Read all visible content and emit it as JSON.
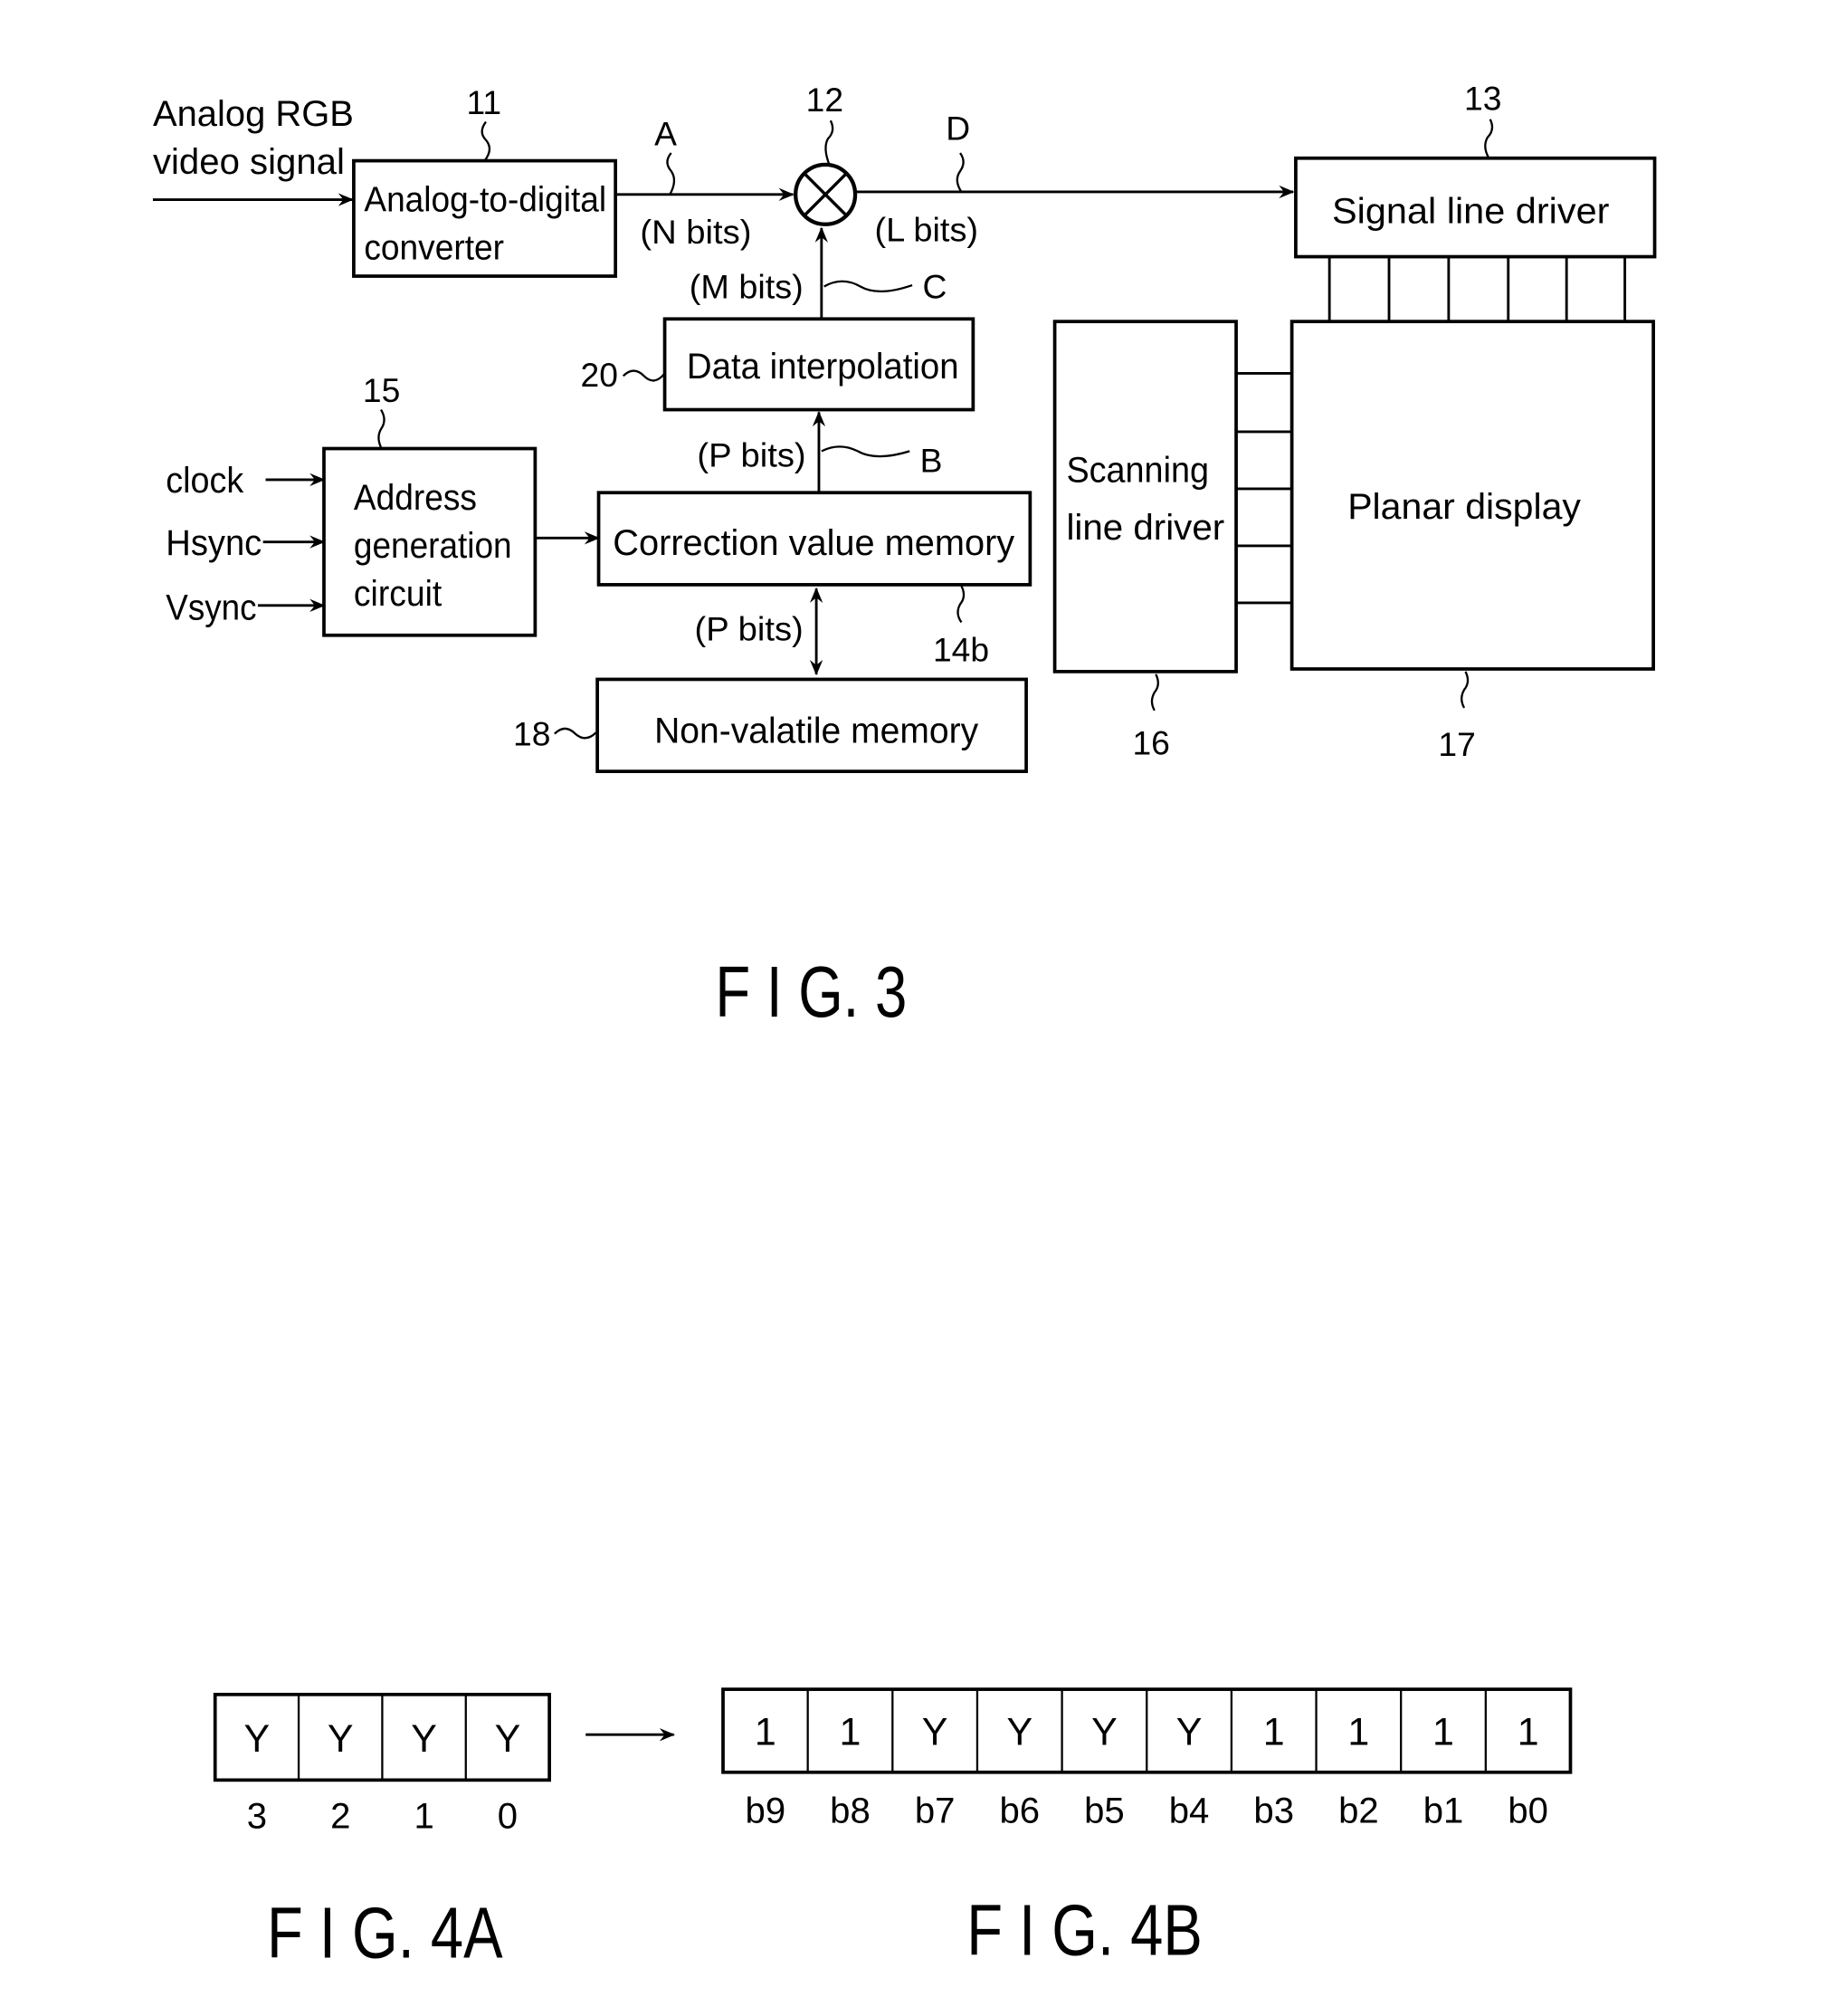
{
  "fig3": {
    "caption": "F I G. 3",
    "input_label_line1": "Analog RGB",
    "input_label_line2": "video signal",
    "adc": {
      "ref": "11",
      "line1": "Analog-to-digital",
      "line2": "converter"
    },
    "multiplier": {
      "ref": "12",
      "symbol": "multiply-circle"
    },
    "signal_a": {
      "name": "A",
      "bits": "(N bits)"
    },
    "signal_d": {
      "name": "D",
      "bits": "(L bits)"
    },
    "signal_c": {
      "name": "C",
      "bits": "(M bits)"
    },
    "signal_b": {
      "name": "B",
      "bits": "(P bits)"
    },
    "signal_mem": {
      "bits": "(P bits)"
    },
    "signal_driver": {
      "ref": "13",
      "label": "Signal line driver"
    },
    "interp": {
      "ref": "20",
      "label": "Data interpolation"
    },
    "address_gen": {
      "ref": "15",
      "line1": "Address",
      "line2": "generation",
      "line3": "circuit"
    },
    "inputs": [
      "clock",
      "Hsync",
      "Vsync"
    ],
    "corr_mem": {
      "ref": "14b",
      "label": "Correction value memory"
    },
    "nv_mem": {
      "ref": "18",
      "label": "Non-valatile memory"
    },
    "scan_driver": {
      "ref": "16",
      "line1": "Scanning",
      "line2": "line driver"
    },
    "display": {
      "ref": "17",
      "label": "Planar display"
    }
  },
  "fig4a": {
    "caption": "F I G. 4A",
    "cells": [
      "Y",
      "Y",
      "Y",
      "Y"
    ],
    "indices": [
      "3",
      "2",
      "1",
      "0"
    ]
  },
  "fig4b": {
    "caption": "F I G. 4B",
    "cells": [
      "1",
      "1",
      "Y",
      "Y",
      "Y",
      "Y",
      "1",
      "1",
      "1",
      "1"
    ],
    "indices": [
      "b9",
      "b8",
      "b7",
      "b6",
      "b5",
      "b4",
      "b3",
      "b2",
      "b1",
      "b0"
    ]
  }
}
